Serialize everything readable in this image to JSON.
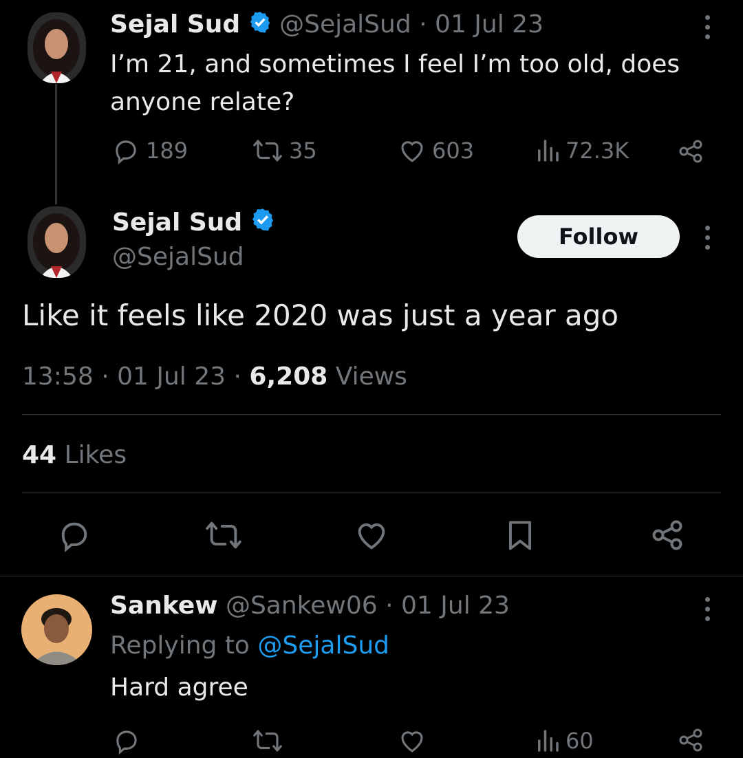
{
  "parent_tweet": {
    "author_name": "Sejal Sud",
    "handle": "@SejalSud",
    "date": "01 Jul 23",
    "separator": "·",
    "text": "I’m 21, and sometimes I feel I’m too old, does anyone relate?",
    "replies": "189",
    "retweets": "35",
    "likes": "603",
    "views": "72.3K"
  },
  "main_tweet": {
    "author_name": "Sejal Sud",
    "handle": "@SejalSud",
    "follow_label": "Follow",
    "text": "Like it feels like 2020 was just a year ago",
    "time": "13:58",
    "date": "01 Jul 23",
    "separator": "·",
    "view_count": "6,208",
    "views_label": "Views",
    "like_count": "44",
    "likes_label": "Likes"
  },
  "reply_tweet": {
    "author_name": "Sankew",
    "handle": "@Sankew06",
    "date": "01 Jul 23",
    "separator": "·",
    "replying_to_label": "Replying to",
    "replying_to_handle": "@SejalSud",
    "text": "Hard agree",
    "views": "60"
  },
  "colors": {
    "background": "#000000",
    "text": "#e7e9ea",
    "muted": "#71767b",
    "accent": "#1d9bf0",
    "divider": "#2f3336"
  },
  "icons": [
    "verified-badge-icon",
    "more-icon",
    "reply-icon",
    "retweet-icon",
    "like-icon",
    "views-icon",
    "share-icon",
    "bookmark-icon"
  ]
}
